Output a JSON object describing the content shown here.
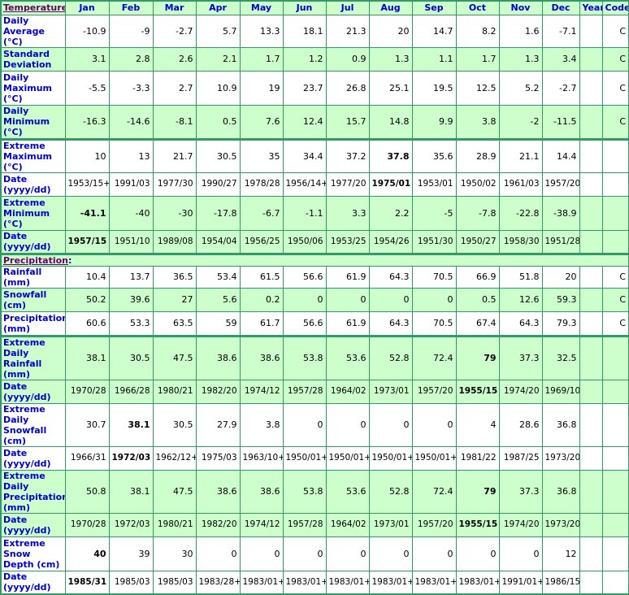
{
  "colors": {
    "border": "#339966",
    "green_row": "#ccffcc",
    "label": "#0000cc",
    "section": "#660066"
  },
  "header": {
    "section": "Temperature",
    "columns": [
      "Jan",
      "Feb",
      "Mar",
      "Apr",
      "May",
      "Jun",
      "Jul",
      "Aug",
      "Sep",
      "Oct",
      "Nov",
      "Dec",
      "Year",
      "Code"
    ]
  },
  "temperature_rows": [
    {
      "label": "Daily Average (°C)",
      "values": [
        "-10.9",
        "-9",
        "-2.7",
        "5.7",
        "13.3",
        "18.1",
        "21.3",
        "20",
        "14.7",
        "8.2",
        "1.6",
        "-7.1",
        "",
        "C"
      ],
      "bold": []
    },
    {
      "label": "Standard Deviation",
      "values": [
        "3.1",
        "2.8",
        "2.6",
        "2.1",
        "1.7",
        "1.2",
        "0.9",
        "1.3",
        "1.1",
        "1.7",
        "1.3",
        "3.4",
        "",
        "C"
      ],
      "bold": []
    },
    {
      "label": "Daily Maximum (°C)",
      "values": [
        "-5.5",
        "-3.3",
        "2.7",
        "10.9",
        "19",
        "23.7",
        "26.8",
        "25.1",
        "19.5",
        "12.5",
        "5.2",
        "-2.7",
        "",
        "C"
      ],
      "bold": []
    },
    {
      "label": "Daily Minimum (°C)",
      "values": [
        "-16.3",
        "-14.6",
        "-8.1",
        "0.5",
        "7.6",
        "12.4",
        "15.7",
        "14.8",
        "9.9",
        "3.8",
        "-2",
        "-11.5",
        "",
        "C"
      ],
      "bold": []
    },
    {
      "label": "Extreme Maximum (°C)",
      "values": [
        "10",
        "13",
        "21.7",
        "30.5",
        "35",
        "34.4",
        "37.2",
        "37.8",
        "35.6",
        "28.9",
        "21.1",
        "14.4",
        "",
        ""
      ],
      "bold": [
        7
      ]
    },
    {
      "label": "Date (yyyy/dd)",
      "values": [
        "1953/15+",
        "1991/03",
        "1977/30",
        "1990/27",
        "1978/28",
        "1956/14+",
        "1977/20",
        "1975/01",
        "1953/01",
        "1950/02",
        "1961/03",
        "1957/20",
        "",
        ""
      ],
      "bold": [
        7
      ]
    },
    {
      "label": "Extreme Minimum (°C)",
      "values": [
        "-41.1",
        "-40",
        "-30",
        "-17.8",
        "-6.7",
        "-1.1",
        "3.3",
        "2.2",
        "-5",
        "-7.8",
        "-22.8",
        "-38.9",
        "",
        ""
      ],
      "bold": [
        0
      ]
    },
    {
      "label": "Date (yyyy/dd)",
      "values": [
        "1957/15",
        "1951/10",
        "1989/08",
        "1954/04",
        "1956/25",
        "1950/06",
        "1953/25",
        "1954/26",
        "1951/30",
        "1950/27",
        "1958/30",
        "1951/28",
        "",
        ""
      ],
      "bold": [
        0
      ]
    }
  ],
  "precipitation": {
    "section": "Precipitation",
    "colon": ":"
  },
  "precipitation_rows": [
    {
      "label": "Rainfall (mm)",
      "values": [
        "10.4",
        "13.7",
        "36.5",
        "53.4",
        "61.5",
        "56.6",
        "61.9",
        "64.3",
        "70.5",
        "66.9",
        "51.8",
        "20",
        "",
        "C"
      ],
      "bold": []
    },
    {
      "label": "Snowfall (cm)",
      "values": [
        "50.2",
        "39.6",
        "27",
        "5.6",
        "0.2",
        "0",
        "0",
        "0",
        "0",
        "0.5",
        "12.6",
        "59.3",
        "",
        "C"
      ],
      "bold": []
    },
    {
      "label": "Precipitation (mm)",
      "values": [
        "60.6",
        "53.3",
        "63.5",
        "59",
        "61.7",
        "56.6",
        "61.9",
        "64.3",
        "70.5",
        "67.4",
        "64.3",
        "79.3",
        "",
        "C"
      ],
      "bold": []
    },
    {
      "label": "Extreme Daily Rainfall (mm)",
      "values": [
        "38.1",
        "30.5",
        "47.5",
        "38.6",
        "38.6",
        "53.8",
        "53.6",
        "52.8",
        "72.4",
        "79",
        "37.3",
        "32.5",
        "",
        ""
      ],
      "bold": [
        9
      ]
    },
    {
      "label": "Date (yyyy/dd)",
      "values": [
        "1970/28",
        "1966/28",
        "1980/21",
        "1982/20",
        "1974/12",
        "1957/28",
        "1964/02",
        "1973/01",
        "1957/20",
        "1955/15",
        "1974/20",
        "1969/10",
        "",
        ""
      ],
      "bold": [
        9
      ]
    },
    {
      "label": "Extreme Daily Snowfall (cm)",
      "values": [
        "30.7",
        "38.1",
        "30.5",
        "27.9",
        "3.8",
        "0",
        "0",
        "0",
        "0",
        "4",
        "28.6",
        "36.8",
        "",
        ""
      ],
      "bold": [
        1
      ]
    },
    {
      "label": "Date (yyyy/dd)",
      "values": [
        "1966/31",
        "1972/03",
        "1962/12+",
        "1975/03",
        "1963/10+",
        "1950/01+",
        "1950/01+",
        "1950/01+",
        "1950/01+",
        "1981/22",
        "1987/25",
        "1973/20",
        "",
        ""
      ],
      "bold": [
        1
      ]
    },
    {
      "label": "Extreme Daily Precipitation (mm)",
      "values": [
        "50.8",
        "38.1",
        "47.5",
        "38.6",
        "38.6",
        "53.8",
        "53.6",
        "52.8",
        "72.4",
        "79",
        "37.3",
        "36.8",
        "",
        ""
      ],
      "bold": [
        9
      ]
    },
    {
      "label": "Date (yyyy/dd)",
      "values": [
        "1970/28",
        "1972/03",
        "1980/21",
        "1982/20",
        "1974/12",
        "1957/28",
        "1964/02",
        "1973/01",
        "1957/20",
        "1955/15",
        "1974/20",
        "1973/20",
        "",
        ""
      ],
      "bold": [
        9
      ]
    },
    {
      "label": "Extreme Snow Depth (cm)",
      "values": [
        "40",
        "39",
        "30",
        "0",
        "0",
        "0",
        "0",
        "0",
        "0",
        "0",
        "0",
        "12",
        "",
        ""
      ],
      "bold": [
        0
      ]
    },
    {
      "label": "Date (yyyy/dd)",
      "values": [
        "1985/31",
        "1985/03",
        "1985/03",
        "1983/28+",
        "1983/01+",
        "1983/01+",
        "1983/01+",
        "1983/01+",
        "1983/01+",
        "1983/01+",
        "1991/01+",
        "1986/15",
        "",
        ""
      ],
      "bold": [
        0
      ]
    }
  ]
}
